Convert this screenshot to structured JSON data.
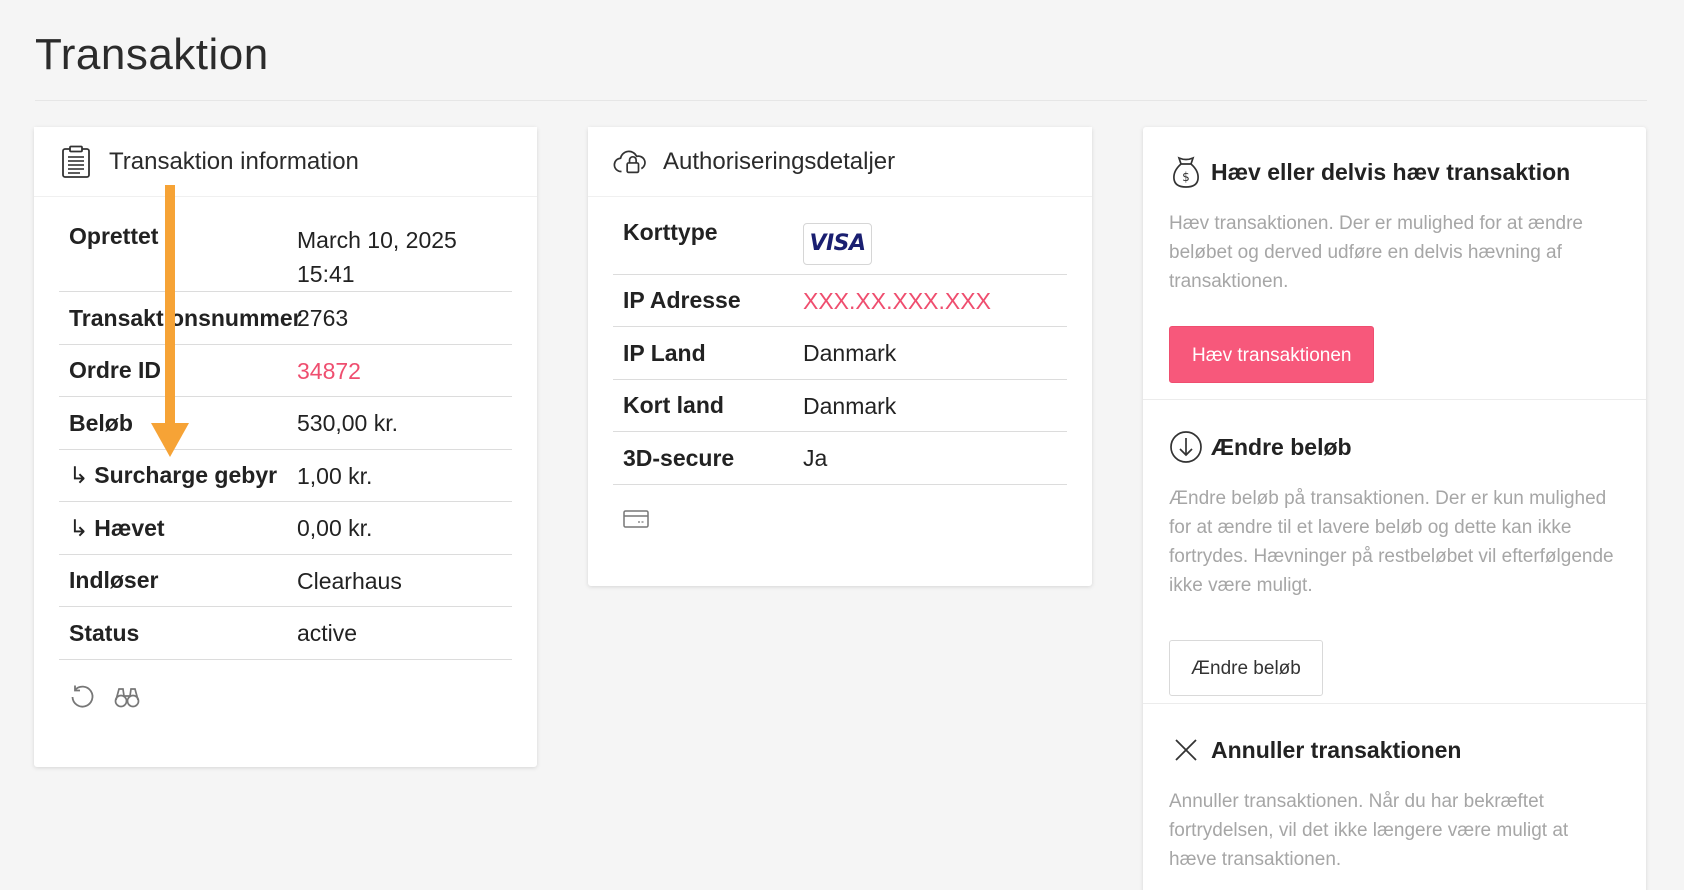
{
  "page": {
    "title": "Transaktion"
  },
  "info_card": {
    "title": "Transaktion information",
    "rows": [
      {
        "key": "Oprettet",
        "value": "March 10, 2025 15:41",
        "value_lines": [
          "March 10, 2025",
          "15:41"
        ]
      },
      {
        "key": "Transaktionsnummer",
        "value": "2763"
      },
      {
        "key": "Ordre ID",
        "value": "34872"
      },
      {
        "key": "Beløb",
        "value": "530,00 kr."
      },
      {
        "key": "Surcharge gebyr",
        "prefix": "↳",
        "value": "1,00 kr."
      },
      {
        "key": "Hævet",
        "prefix": "↳",
        "value": "0,00 kr."
      },
      {
        "key": "Indløser",
        "value": "Clearhaus"
      },
      {
        "key": "Status",
        "value": "active"
      }
    ],
    "footer_icons": [
      "refresh-icon",
      "binoculars-icon"
    ]
  },
  "auth_card": {
    "title": "Authoriseringsdetaljer",
    "rows": [
      {
        "key": "Korttype",
        "value": "VISA"
      },
      {
        "key": "IP Adresse",
        "value": "XXX.XX.XXX.XXX"
      },
      {
        "key": "IP Land",
        "value": "Danmark"
      },
      {
        "key": "Kort land",
        "value": "Danmark"
      },
      {
        "key": "3D-secure",
        "value": "Ja"
      }
    ],
    "footer_icons": [
      "credit-card-icon"
    ]
  },
  "actions_card": {
    "capture": {
      "title": "Hæv eller delvis hæv transaktion",
      "description": "Hæv transaktionen. Der er mulighed for at ændre beløbet og derved udføre en delvis hævning af transaktionen.",
      "button": "Hæv transaktionen"
    },
    "change_amount": {
      "title": "Ændre beløb",
      "description": "Ændre beløb på transaktionen. Der er kun mulighed for at ændre til et lavere beløb og dette kan ikke fortrydes. Hævninger på restbeløbet vil efterfølgende ikke være muligt.",
      "button": "Ændre beløb"
    },
    "cancel": {
      "title": "Annuller transaktionen",
      "description": "Annuller transaktionen. Når du har bekræftet fortrydelsen, vil det ikke længere være muligt at hæve transaktionen."
    }
  },
  "colors": {
    "accent_pink": "#f7587b",
    "link_pink": "#ef4e6f",
    "annotation_arrow": "#f6a336",
    "visa_blue": "#1a1f71"
  }
}
